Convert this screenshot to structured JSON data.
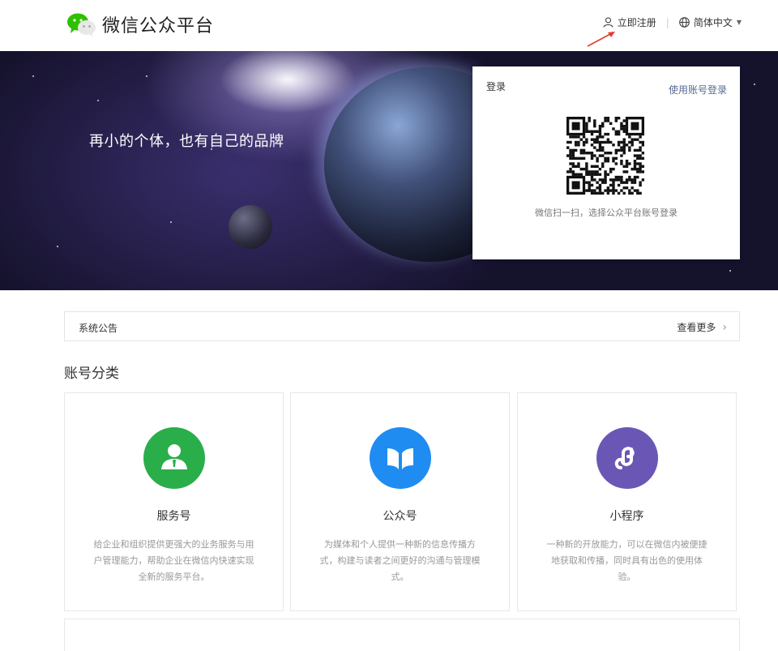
{
  "header": {
    "brand": "微信公众平台",
    "register_label": "立即注册",
    "separator": "|",
    "language_label": "简体中文"
  },
  "banner": {
    "slogan": "再小的个体，也有自己的品牌"
  },
  "login": {
    "title": "登录",
    "switch_label": "使用账号登录",
    "qr_tip": "微信扫一扫，选择公众平台账号登录"
  },
  "notice": {
    "title": "系统公告",
    "more_label": "查看更多"
  },
  "categories": {
    "title": "账号分类",
    "items": [
      {
        "name": "服务号",
        "desc": "给企业和组织提供更强大的业务服务与用户管理能力，帮助企业在微信内快速实现全新的服务平台。",
        "color": "#2aae4a",
        "icon": "person-icon"
      },
      {
        "name": "公众号",
        "desc": "为媒体和个人提供一种新的信息传播方式，构建与读者之间更好的沟通与管理模式。",
        "color": "#1f8cf2",
        "icon": "book-icon"
      },
      {
        "name": "小程序",
        "desc": "一种新的开放能力，可以在微信内被便捷地获取和传播，同时具有出色的使用体验。",
        "color": "#6a57b5",
        "icon": "mini-program-icon"
      }
    ]
  },
  "colors": {
    "link": "#576b95",
    "brand_green": "#2aae4a",
    "annotation_arrow": "#e23b2c"
  }
}
